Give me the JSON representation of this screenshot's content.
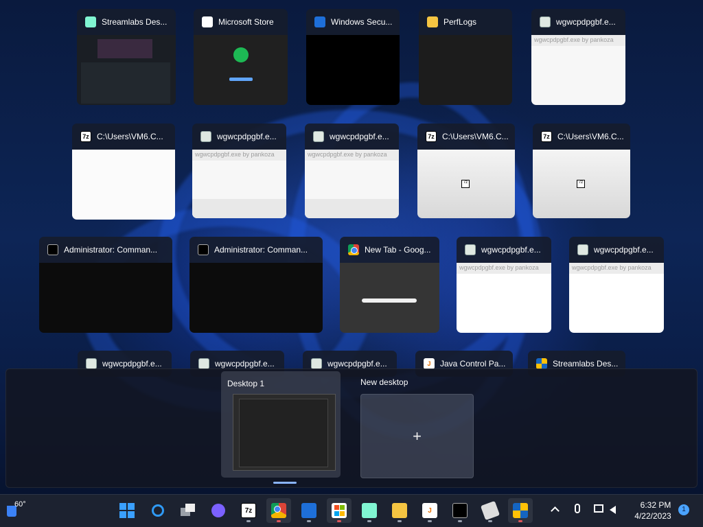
{
  "windows": [
    {
      "title": "Streamlabs Des...",
      "icon": "streamlabs-icon"
    },
    {
      "title": "Microsoft Store",
      "icon": "store-icon"
    },
    {
      "title": "Windows Secu...",
      "icon": "shield-icon"
    },
    {
      "title": "PerfLogs",
      "icon": "folder-icon"
    },
    {
      "title": "wgwcpdpgbf.e...",
      "icon": "exe-icon",
      "caption": "wgwcpdpgbf.exe by pankoza"
    },
    {
      "title": "C:\\Users\\VM6.C...",
      "icon": "7zip-icon"
    },
    {
      "title": "wgwcpdpgbf.e...",
      "icon": "exe-icon",
      "caption": "wgwcpdpgbf.exe by pankoza"
    },
    {
      "title": "wgwcpdpgbf.e...",
      "icon": "exe-icon",
      "caption": "wgwcpdpgbf.exe by pankoza"
    },
    {
      "title": "C:\\Users\\VM6.C...",
      "icon": "7zip-icon"
    },
    {
      "title": "C:\\Users\\VM6.C...",
      "icon": "7zip-icon"
    },
    {
      "title": "Administrator: Comman...",
      "icon": "cmd-icon"
    },
    {
      "title": "Administrator: Comman...",
      "icon": "cmd-icon"
    },
    {
      "title": "New Tab - Goog...",
      "icon": "chrome-icon"
    },
    {
      "title": "wgwcpdpgbf.e...",
      "icon": "exe-icon",
      "caption": "wgwcpdpgbf.exe by pankoza"
    },
    {
      "title": "wgwcpdpgbf.e...",
      "icon": "exe-icon",
      "caption": "wgwcpdpgbf.exe by pankoza"
    },
    {
      "title": "wgwcpdpgbf.e...",
      "icon": "exe-icon"
    },
    {
      "title": "wgwcpdpgbf.e...",
      "icon": "exe-icon"
    },
    {
      "title": "wgwcpdpgbf.e...",
      "icon": "exe-icon"
    },
    {
      "title": "Java Control Pa...",
      "icon": "java-icon"
    },
    {
      "title": "Streamlabs Des...",
      "icon": "shield-icon"
    }
  ],
  "desktops": {
    "current_label": "Desktop 1",
    "new_label": "New desktop",
    "new_symbol": "+"
  },
  "taskbar": {
    "weather_temp": "60°",
    "apps": [
      "start",
      "search",
      "task-view",
      "meet",
      "7-zip",
      "chrome",
      "windows-security",
      "microsoft-store",
      "streamlabs",
      "file-explorer",
      "java",
      "cmd",
      "wgwcpdpgbf",
      "windows-security-2"
    ],
    "time": "6:32 PM",
    "date": "4/22/2023",
    "notification_count": "1"
  },
  "colors": {
    "taskbar_bg": "#1c2230",
    "accent": "#1e6fd9",
    "running_indicator_red": "#e0555a"
  }
}
